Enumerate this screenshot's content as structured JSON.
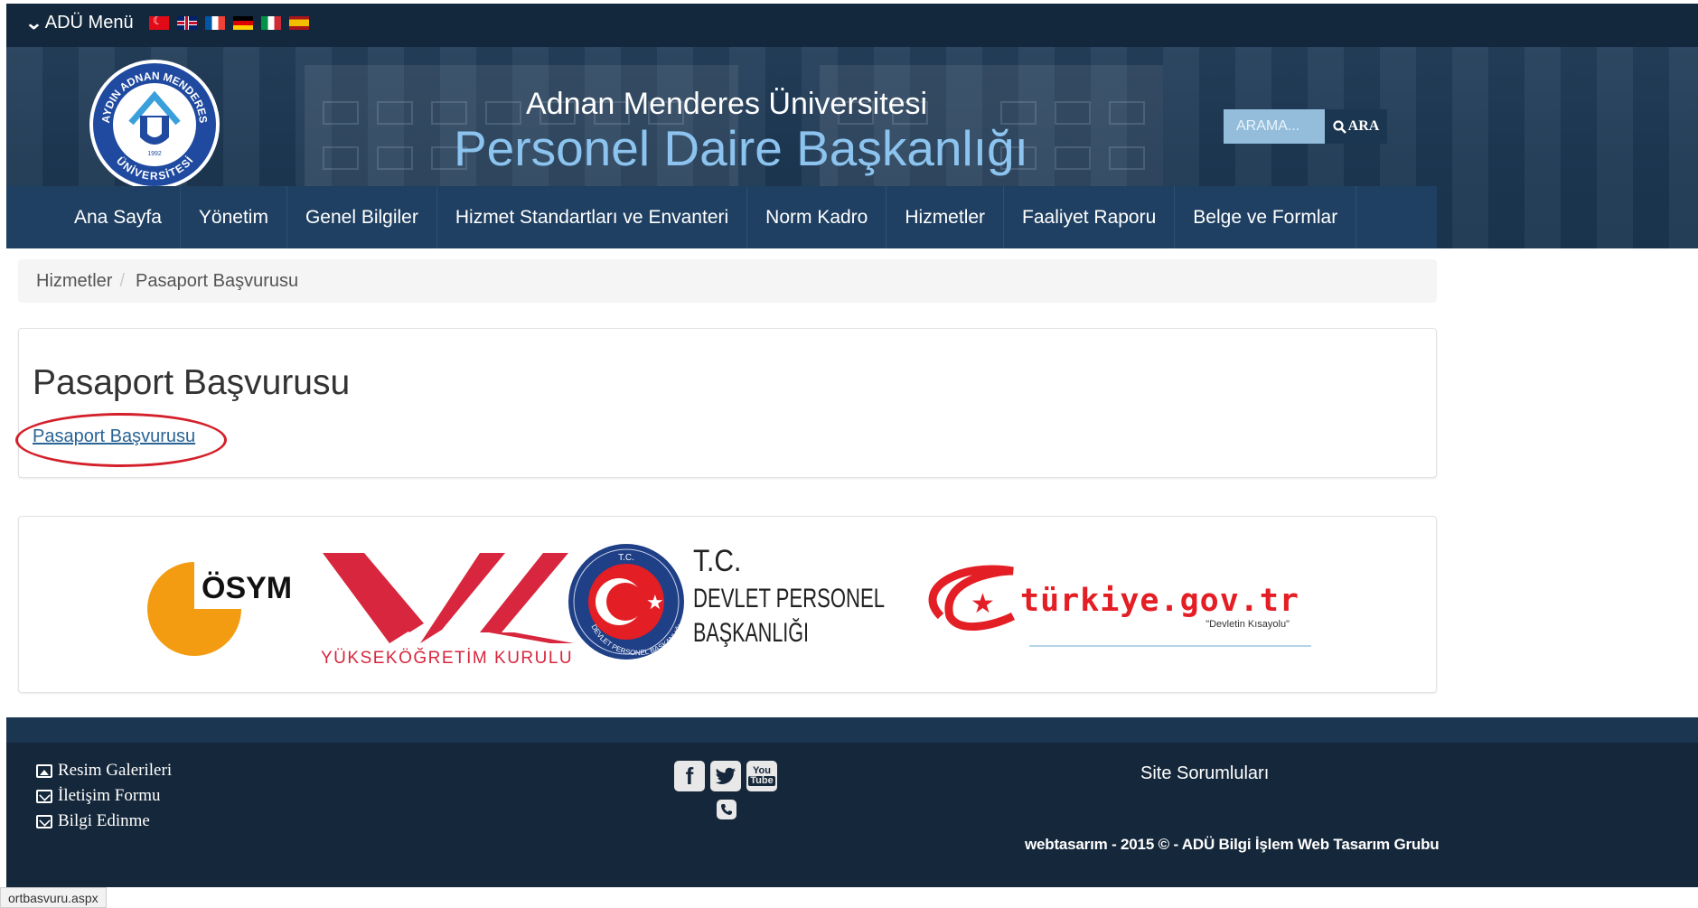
{
  "topbar": {
    "menu_label": "ADÜ Menü",
    "flags": [
      "tr",
      "en",
      "fr",
      "de",
      "it",
      "es"
    ]
  },
  "header": {
    "university": "Adnan Menderes Üniversitesi",
    "department": "Personel Daire Başkanlığı",
    "search_placeholder": "ARAMA...",
    "search_button": "ARA",
    "logo": {
      "top_text": "AYDIN ADNAN MENDERES",
      "bottom_text": "ÜNİVERSİTESİ",
      "year": "1992"
    }
  },
  "nav": {
    "items": [
      "Ana Sayfa",
      "Yönetim",
      "Genel Bilgiler",
      "Hizmet Standartları ve Envanteri",
      "Norm Kadro",
      "Hizmetler",
      "Faaliyet Raporu",
      "Belge ve Formlar"
    ]
  },
  "breadcrumb": {
    "parent": "Hizmetler",
    "separator": "/",
    "current": "Pasaport Başvurusu"
  },
  "content": {
    "title": "Pasaport Başvurusu",
    "link": "Pasaport Başvurusu"
  },
  "partners": {
    "osym": "ÖSYM",
    "yok": "YÜKSEKÖĞRETİM KURULU",
    "dpb_line1": "T.C.",
    "dpb_line2": "DEVLET PERSONEL",
    "dpb_line3": "BAŞKANLIĞI",
    "dpb_seal_top": "T.C.",
    "dpb_seal_ring": "DEVLET PERSONEL BAŞKANLIĞI",
    "turkiye": "türkiye.gov.tr",
    "turkiye_tagline": "\"Devletin Kısayolu\""
  },
  "footer": {
    "links": [
      "Resim Galerileri",
      "İletişim Formu",
      "Bilgi Edinme"
    ],
    "site_responsible": "Site Sorumluları",
    "copyright": "webtasarım - 2015 © - ADÜ Bilgi İşlem Web Tasarım Grubu",
    "youtube_top": "You",
    "youtube_bottom": "Tube"
  },
  "statusbar": {
    "url": "ortbasvuru.aspx"
  },
  "colors": {
    "topbar": "#13283d",
    "header": "#1b3651",
    "nav": "#1f4062",
    "dept_title": "#8cc4ef",
    "link": "#2a6496",
    "highlight_ellipse": "#d4202a",
    "footer": "#15273a"
  }
}
